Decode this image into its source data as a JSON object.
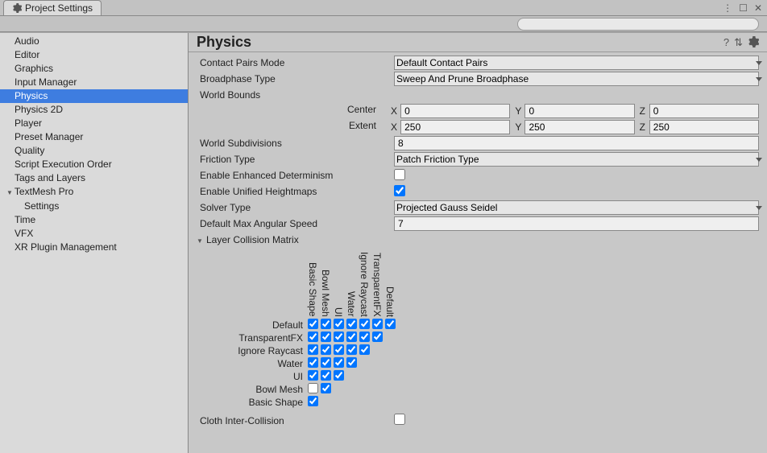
{
  "window": {
    "title": "Project Settings"
  },
  "search": {
    "placeholder": ""
  },
  "sidebar": {
    "items": [
      {
        "label": "Audio"
      },
      {
        "label": "Editor"
      },
      {
        "label": "Graphics"
      },
      {
        "label": "Input Manager"
      },
      {
        "label": "Physics",
        "selected": true
      },
      {
        "label": "Physics 2D"
      },
      {
        "label": "Player"
      },
      {
        "label": "Preset Manager"
      },
      {
        "label": "Quality"
      },
      {
        "label": "Script Execution Order"
      },
      {
        "label": "Tags and Layers"
      },
      {
        "label": "TextMesh Pro",
        "parent": true
      },
      {
        "label": "Settings",
        "child": true
      },
      {
        "label": "Time"
      },
      {
        "label": "VFX"
      },
      {
        "label": "XR Plugin Management"
      }
    ]
  },
  "heading": "Physics",
  "fields": {
    "contact_pairs_mode": {
      "label": "Contact Pairs Mode",
      "value": "Default Contact Pairs"
    },
    "broadphase_type": {
      "label": "Broadphase Type",
      "value": "Sweep And Prune Broadphase"
    },
    "world_bounds": {
      "label": "World Bounds"
    },
    "center": {
      "label": "Center",
      "x": "0",
      "y": "0",
      "z": "0"
    },
    "extent": {
      "label": "Extent",
      "x": "250",
      "y": "250",
      "z": "250"
    },
    "world_subdivisions": {
      "label": "World Subdivisions",
      "value": "8"
    },
    "friction_type": {
      "label": "Friction Type",
      "value": "Patch Friction Type"
    },
    "enable_enhanced_determinism": {
      "label": "Enable Enhanced Determinism",
      "value": false
    },
    "enable_unified_heightmaps": {
      "label": "Enable Unified Heightmaps",
      "value": true
    },
    "solver_type": {
      "label": "Solver Type",
      "value": "Projected Gauss Seidel"
    },
    "default_max_angular_speed": {
      "label": "Default Max Angular Speed",
      "value": "7"
    },
    "layer_collision_matrix": {
      "label": "Layer Collision Matrix"
    },
    "cloth_inter_collision": {
      "label": "Cloth Inter-Collision",
      "value": false
    }
  },
  "axis": {
    "x": "X",
    "y": "Y",
    "z": "Z"
  },
  "matrix": {
    "columns_top_to_bottom_left_to_right": [
      "Basic Shape",
      "Bowl Mesh",
      "UI",
      "Water",
      "Ignore Raycast",
      "TransparentFX",
      "Default"
    ],
    "rows": [
      "Default",
      "TransparentFX",
      "Ignore Raycast",
      "Water",
      "UI",
      "Bowl Mesh",
      "Basic Shape"
    ],
    "cells": [
      [
        true,
        true,
        true,
        true,
        true,
        true,
        true
      ],
      [
        true,
        true,
        true,
        true,
        true,
        true
      ],
      [
        true,
        true,
        true,
        true,
        true
      ],
      [
        true,
        true,
        true,
        true
      ],
      [
        true,
        true,
        true
      ],
      [
        false,
        true
      ],
      [
        true
      ]
    ]
  },
  "titlebar_icons": {
    "menu": "⋮",
    "max": "☐",
    "close": "✕"
  },
  "heading_icons": {
    "help": "?",
    "sort": "⇅"
  }
}
